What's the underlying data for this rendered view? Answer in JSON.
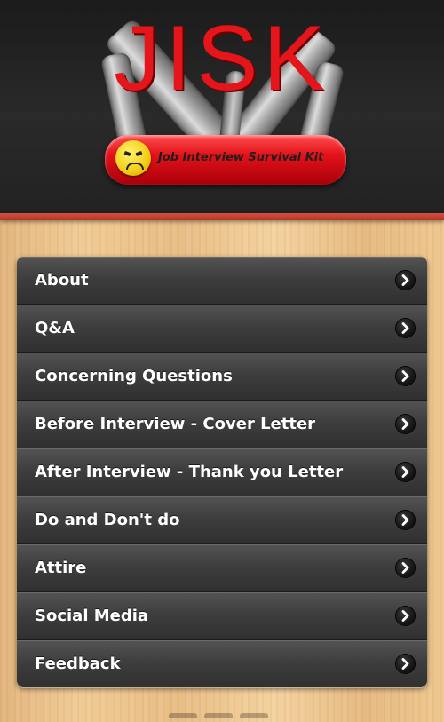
{
  "header": {
    "logo_text": "JISK",
    "subtitle": "Job Interview Survival Kit"
  },
  "menu": {
    "items": [
      {
        "label": "About"
      },
      {
        "label": "Q&A"
      },
      {
        "label": "Concerning Questions"
      },
      {
        "label": "Before Interview - Cover Letter"
      },
      {
        "label": "After Interview - Thank you Letter"
      },
      {
        "label": "Do and Don't do"
      },
      {
        "label": "Attire"
      },
      {
        "label": "Social Media"
      },
      {
        "label": "Feedback"
      }
    ]
  },
  "icons": {
    "item_chevron": "chevron-right-icon",
    "emblem": "worried-face-icon"
  },
  "colors": {
    "logo_red": "#e4161b",
    "header_stripe": "#d4503f",
    "menu_dark": "#333333"
  }
}
